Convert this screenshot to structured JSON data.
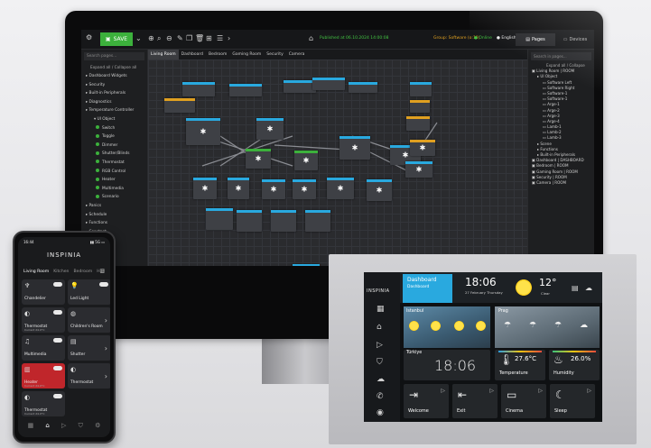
{
  "monitor": {
    "toolbar": {
      "save_label": "SAVE",
      "status": "Published at 06.10.2024 14:00:08",
      "group": "Group: Software (o:10)",
      "online": "Online",
      "language": "English",
      "tab_pages": "Pages",
      "tab_devices": "Devices"
    },
    "left_sidebar": {
      "search_placeholder": "Search pages...",
      "breadcrumb": "Expand all / Collapse all",
      "items": [
        {
          "label": "Dashboard Widgets",
          "indent": 0
        },
        {
          "label": "Security",
          "indent": 0
        },
        {
          "label": "Built-in Peripherals",
          "indent": 0
        },
        {
          "label": "Diagnostics",
          "indent": 0
        },
        {
          "label": "Temperature Controller",
          "indent": 0
        },
        {
          "label": "UI Object",
          "indent": 1
        },
        {
          "label": "Switch",
          "indent": 2
        },
        {
          "label": "Toggle",
          "indent": 2
        },
        {
          "label": "Dimmer",
          "indent": 2
        },
        {
          "label": "Shutter/Blinds",
          "indent": 2
        },
        {
          "label": "Thermostat",
          "indent": 2
        },
        {
          "label": "RGB Control",
          "indent": 2
        },
        {
          "label": "Heater",
          "indent": 2
        },
        {
          "label": "Multimedia",
          "indent": 2
        },
        {
          "label": "Scenario",
          "indent": 2
        },
        {
          "label": "Panics",
          "indent": 0
        },
        {
          "label": "Schedule",
          "indent": 0
        },
        {
          "label": "Functions",
          "indent": 0
        },
        {
          "label": "Constant",
          "indent": 0
        },
        {
          "label": "Math",
          "indent": 0
        }
      ]
    },
    "tabs": [
      "Living Room",
      "Dashboard",
      "Bedroom",
      "Gaming Room",
      "Security",
      "Camera"
    ],
    "right_sidebar": {
      "search_placeholder": "Search in pages...",
      "breadcrumb": "Expand all / Collapse",
      "tree": [
        {
          "label": "Living Room | ROOM",
          "indent": 0
        },
        {
          "label": "UI Object",
          "indent": 1
        },
        {
          "label": "Software Left",
          "indent": 2
        },
        {
          "label": "Software Right",
          "indent": 2
        },
        {
          "label": "Software-1",
          "indent": 2
        },
        {
          "label": "Software-1",
          "indent": 2
        },
        {
          "label": "Arge-1",
          "indent": 2
        },
        {
          "label": "Arge-2",
          "indent": 2
        },
        {
          "label": "Arge-3",
          "indent": 2
        },
        {
          "label": "Arge-4",
          "indent": 2
        },
        {
          "label": "Lamb-1",
          "indent": 2
        },
        {
          "label": "Lamb-2",
          "indent": 2
        },
        {
          "label": "Lamb-3",
          "indent": 2
        },
        {
          "label": "Scene",
          "indent": 1
        },
        {
          "label": "Functions",
          "indent": 1
        },
        {
          "label": "Built-in Peripherals",
          "indent": 1
        },
        {
          "label": "Dashboard | DASHBOARD",
          "indent": 0
        },
        {
          "label": "Bedroom | ROOM",
          "indent": 0
        },
        {
          "label": "Gaming Room | ROOM",
          "indent": 0
        },
        {
          "label": "Security | ROOM",
          "indent": 0
        },
        {
          "label": "Camera | ROOM",
          "indent": 0
        }
      ]
    }
  },
  "phone": {
    "time": "16:44",
    "signal": "5G",
    "logo": "INSPINIA",
    "tabs": [
      "Living Room",
      "Kitchen",
      "Bedroom",
      "Hall"
    ],
    "tiles": [
      {
        "label": "Chandelier",
        "sub": "",
        "icon": "chandelier-icon",
        "accent": "#2b2c30"
      },
      {
        "label": "Led Light",
        "sub": "",
        "icon": "bulb-icon",
        "accent": "#2b2c30"
      },
      {
        "label": "Thermostat",
        "sub": "Current 24.0°C",
        "icon": "thermostat-icon",
        "accent": "#2b2c30"
      },
      {
        "label": "Children's Room",
        "sub": "",
        "icon": "rgb-icon",
        "accent": "#2b2c30"
      },
      {
        "label": "Multimedia",
        "sub": "",
        "icon": "music-icon",
        "accent": "#2b2c30"
      },
      {
        "label": "Shutter",
        "sub": "",
        "icon": "shutter-icon",
        "accent": "#2b2c30"
      },
      {
        "label": "Heater",
        "sub": "Current 24.0°C",
        "icon": "heater-icon",
        "accent": "#c0262b"
      },
      {
        "label": "Thermostat",
        "sub": "",
        "icon": "thermostat-icon",
        "accent": "#2b2c30"
      },
      {
        "label": "Thermostat",
        "sub": "Current 24.0°C",
        "icon": "thermostat-icon",
        "accent": "#2b2c30"
      }
    ]
  },
  "tablet": {
    "logo": "INSPINIA",
    "dashboard_title": "Dashboard",
    "dashboard_sub": "Dashboard",
    "time": "18:06",
    "date": "27 February Thursday",
    "outdoor_temp": "12°",
    "outdoor_sub": "Clear",
    "city1": "Istanbul",
    "city2": "Prag",
    "city3": "Türkiye",
    "clock_big": "18:06",
    "temperature_value": "27.6°C",
    "temperature_label": "Temperature",
    "humidity_value": "26.0%",
    "humidity_label": "Humidity",
    "scenes": [
      {
        "label": "Welcome",
        "icon": "enter-icon"
      },
      {
        "label": "Exit",
        "icon": "exit-icon"
      },
      {
        "label": "Cinema",
        "icon": "tv-icon"
      },
      {
        "label": "Sleep",
        "icon": "moon-icon"
      }
    ],
    "colors": {
      "accent": "#29a9df",
      "sun": "#ffd21a"
    }
  }
}
